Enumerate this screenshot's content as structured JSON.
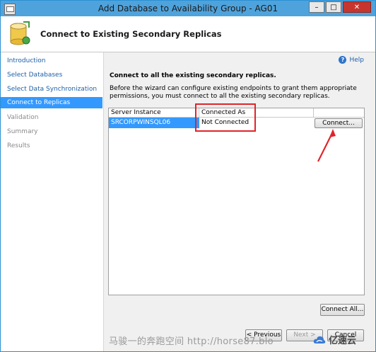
{
  "window": {
    "title": "Add Database to Availability Group - AG01",
    "buttons": {
      "minimize": "–",
      "maximize": "□",
      "close": "✕"
    }
  },
  "header": {
    "title": "Connect to Existing Secondary Replicas"
  },
  "nav": {
    "items": [
      {
        "label": "Introduction",
        "state": "link"
      },
      {
        "label": "Select Databases",
        "state": "link"
      },
      {
        "label": "Select Data Synchronization",
        "state": "link"
      },
      {
        "label": "Connect to Replicas",
        "state": "active"
      },
      {
        "label": "Validation",
        "state": "disabled"
      },
      {
        "label": "Summary",
        "state": "disabled"
      },
      {
        "label": "Results",
        "state": "disabled"
      }
    ]
  },
  "help": {
    "label": "Help"
  },
  "main": {
    "section_title": "Connect to all the existing secondary replicas.",
    "description": "Before the wizard can configure existing endpoints to grant them appropriate permissions, you must connect to all the existing secondary replicas.",
    "grid": {
      "columns": [
        "Server Instance",
        "Connected As",
        ""
      ],
      "rows": [
        {
          "server_instance": "SRCORPWINSQL06",
          "connected_as": "Not Connected",
          "action": "Connect..."
        }
      ]
    },
    "connect_all_label": "Connect All..."
  },
  "footer": {
    "previous_label": "< Previous",
    "next_label": "Next >",
    "cancel_label": "Cancel"
  },
  "overlay": {
    "watermark": "马骏一的奔跑空间 http://horse87.blo",
    "brand": "亿速云",
    "annotation_color": "#e0242a"
  }
}
